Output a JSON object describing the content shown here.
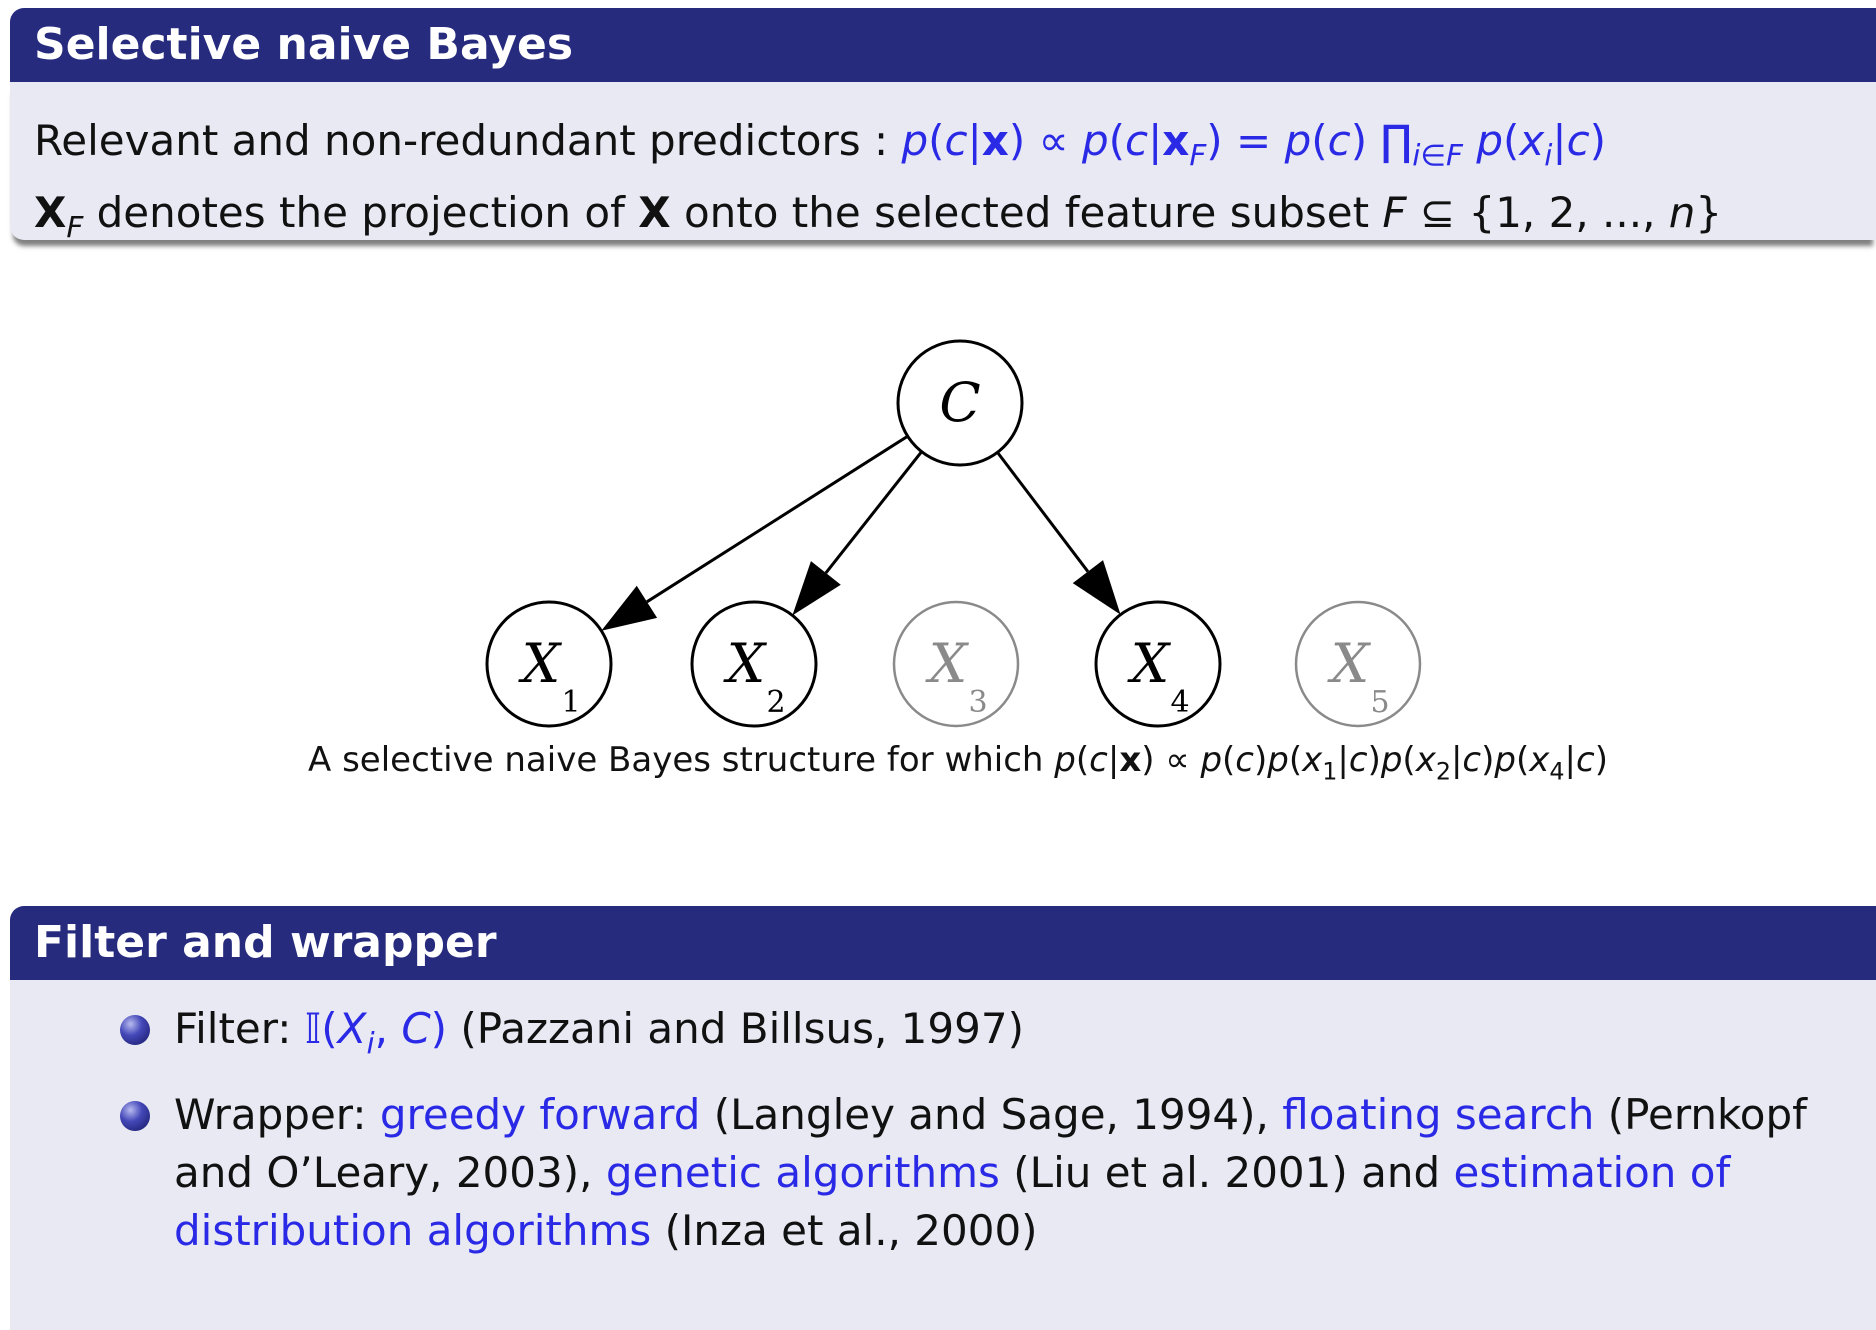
{
  "block1": {
    "title": "Selective naive Bayes",
    "line1_text": "Relevant and non-redundant predictors : ",
    "line2_text": " denotes the projection of ",
    "line2_text2": " onto the selected feature subset "
  },
  "diagram": {
    "nodes": [
      {
        "id": "C",
        "label": "C",
        "sub": "",
        "selected": true
      },
      {
        "id": "X1",
        "label": "X",
        "sub": "1",
        "selected": true
      },
      {
        "id": "X2",
        "label": "X",
        "sub": "2",
        "selected": true
      },
      {
        "id": "X3",
        "label": "X",
        "sub": "3",
        "selected": false
      },
      {
        "id": "X4",
        "label": "X",
        "sub": "4",
        "selected": true
      },
      {
        "id": "X5",
        "label": "X",
        "sub": "5",
        "selected": false
      }
    ],
    "edges": [
      [
        "C",
        "X1"
      ],
      [
        "C",
        "X2"
      ],
      [
        "C",
        "X4"
      ]
    ],
    "colors": {
      "selected": "#000000",
      "unselected": "#8a8a8a"
    }
  },
  "caption": {
    "text": "A selective naive Bayes structure for which "
  },
  "block2": {
    "title": "Filter and wrapper",
    "items": [
      {
        "prefix": "Filter: ",
        "suffix": " (Pazzani and Billsus, 1997)"
      },
      {
        "prefix": "Wrapper: ",
        "link1": "greedy forward",
        "text1": " (Langley and Sage, 1994), ",
        "link2": "floating search",
        "text2": " (Pernkopf and O’Leary, 2003), ",
        "link3": "genetic algorithms",
        "text3": " (Liu et al. 2001) and ",
        "link4": "estimation of distribution algorithms",
        "text4": " (Inza et al., 2000)"
      }
    ]
  },
  "colors": {
    "title_bar": "#262b7e",
    "body_bg": "#e8e9f3",
    "math": "#2a2ae6"
  }
}
